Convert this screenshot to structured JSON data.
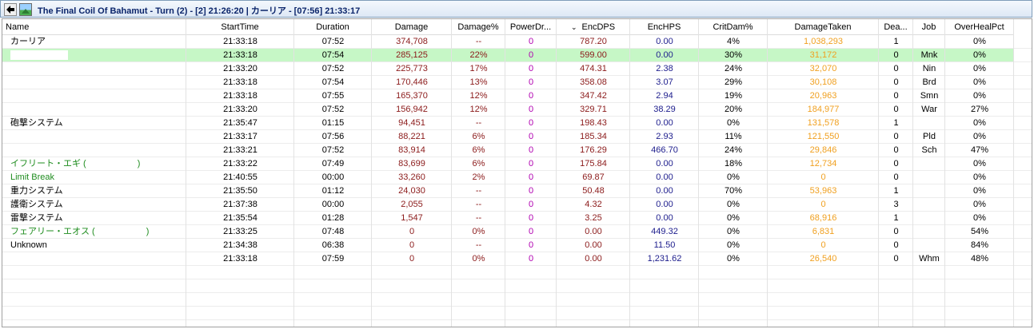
{
  "window": {
    "title": "The Final Coil Of Bahamut - Turn (2) - [2] 21:26:20 | カーリア - [07:56] 21:33:17"
  },
  "columns": [
    {
      "key": "name",
      "label": "Name"
    },
    {
      "key": "start",
      "label": "StartTime"
    },
    {
      "key": "duration",
      "label": "Duration"
    },
    {
      "key": "damage",
      "label": "Damage"
    },
    {
      "key": "damagepct",
      "label": "Damage%"
    },
    {
      "key": "powerdrain",
      "label": "PowerDr..."
    },
    {
      "key": "encdps",
      "label": "EncDPS",
      "sort_icon": "⌄"
    },
    {
      "key": "enchps",
      "label": "EncHPS"
    },
    {
      "key": "critdam",
      "label": "CritDam%"
    },
    {
      "key": "damagetaken",
      "label": "DamageTaken"
    },
    {
      "key": "deaths",
      "label": "Dea..."
    },
    {
      "key": "job",
      "label": "Job"
    },
    {
      "key": "overheal",
      "label": "OverHealPct"
    }
  ],
  "rows": [
    {
      "name": "カーリア",
      "start": "21:33:18",
      "duration": "07:52",
      "damage": "374,708",
      "damagepct": "--",
      "powerdrain": "0",
      "encdps": "787.20",
      "enchps": "0.00",
      "critdam": "4%",
      "damagetaken": "1,038,293",
      "deaths": "1",
      "job": "",
      "overheal": "0%",
      "name_color": "black"
    },
    {
      "name": "",
      "start": "21:33:18",
      "duration": "07:54",
      "damage": "285,125",
      "damagepct": "22%",
      "powerdrain": "0",
      "encdps": "599.00",
      "enchps": "0.00",
      "critdam": "30%",
      "damagetaken": "31,172",
      "deaths": "0",
      "job": "Mnk",
      "overheal": "0%",
      "name_color": "black",
      "selected": true
    },
    {
      "name": "",
      "start": "21:33:20",
      "duration": "07:52",
      "damage": "225,773",
      "damagepct": "17%",
      "powerdrain": "0",
      "encdps": "474.31",
      "enchps": "2.38",
      "critdam": "24%",
      "damagetaken": "32,070",
      "deaths": "0",
      "job": "Nin",
      "overheal": "0%",
      "name_color": "black"
    },
    {
      "name": "",
      "start": "21:33:18",
      "duration": "07:54",
      "damage": "170,446",
      "damagepct": "13%",
      "powerdrain": "0",
      "encdps": "358.08",
      "enchps": "3.07",
      "critdam": "29%",
      "damagetaken": "30,108",
      "deaths": "0",
      "job": "Brd",
      "overheal": "0%",
      "name_color": "black"
    },
    {
      "name": "",
      "start": "21:33:18",
      "duration": "07:55",
      "damage": "165,370",
      "damagepct": "12%",
      "powerdrain": "0",
      "encdps": "347.42",
      "enchps": "2.94",
      "critdam": "19%",
      "damagetaken": "20,963",
      "deaths": "0",
      "job": "Smn",
      "overheal": "0%",
      "name_color": "black"
    },
    {
      "name": "",
      "start": "21:33:20",
      "duration": "07:52",
      "damage": "156,942",
      "damagepct": "12%",
      "powerdrain": "0",
      "encdps": "329.71",
      "enchps": "38.29",
      "critdam": "20%",
      "damagetaken": "184,977",
      "deaths": "0",
      "job": "War",
      "overheal": "27%",
      "name_color": "black"
    },
    {
      "name": "砲撃システム",
      "start": "21:35:47",
      "duration": "01:15",
      "damage": "94,451",
      "damagepct": "--",
      "powerdrain": "0",
      "encdps": "198.43",
      "enchps": "0.00",
      "critdam": "0%",
      "damagetaken": "131,578",
      "deaths": "1",
      "job": "",
      "overheal": "0%",
      "name_color": "black"
    },
    {
      "name": "",
      "start": "21:33:17",
      "duration": "07:56",
      "damage": "88,221",
      "damagepct": "6%",
      "powerdrain": "0",
      "encdps": "185.34",
      "enchps": "2.93",
      "critdam": "11%",
      "damagetaken": "121,550",
      "deaths": "0",
      "job": "Pld",
      "overheal": "0%",
      "name_color": "black"
    },
    {
      "name": "",
      "start": "21:33:21",
      "duration": "07:52",
      "damage": "83,914",
      "damagepct": "6%",
      "powerdrain": "0",
      "encdps": "176.29",
      "enchps": "466.70",
      "critdam": "24%",
      "damagetaken": "29,846",
      "deaths": "0",
      "job": "Sch",
      "overheal": "47%",
      "name_color": "black"
    },
    {
      "name": "イフリート・エギ (",
      "name_suffix": ")",
      "start": "21:33:22",
      "duration": "07:49",
      "damage": "83,699",
      "damagepct": "6%",
      "powerdrain": "0",
      "encdps": "175.84",
      "enchps": "0.00",
      "critdam": "18%",
      "damagetaken": "12,734",
      "deaths": "0",
      "job": "",
      "overheal": "0%",
      "name_color": "green"
    },
    {
      "name": "Limit Break",
      "start": "21:40:55",
      "duration": "00:00",
      "damage": "33,260",
      "damagepct": "2%",
      "powerdrain": "0",
      "encdps": "69.87",
      "enchps": "0.00",
      "critdam": "0%",
      "damagetaken": "0",
      "deaths": "0",
      "job": "",
      "overheal": "0%",
      "name_color": "green"
    },
    {
      "name": "重力システム",
      "start": "21:35:50",
      "duration": "01:12",
      "damage": "24,030",
      "damagepct": "--",
      "powerdrain": "0",
      "encdps": "50.48",
      "enchps": "0.00",
      "critdam": "70%",
      "damagetaken": "53,963",
      "deaths": "1",
      "job": "",
      "overheal": "0%",
      "name_color": "black"
    },
    {
      "name": "護衛システム",
      "start": "21:37:38",
      "duration": "00:00",
      "damage": "2,055",
      "damagepct": "--",
      "powerdrain": "0",
      "encdps": "4.32",
      "enchps": "0.00",
      "critdam": "0%",
      "damagetaken": "0",
      "deaths": "3",
      "job": "",
      "overheal": "0%",
      "name_color": "black"
    },
    {
      "name": "雷撃システム",
      "start": "21:35:54",
      "duration": "01:28",
      "damage": "1,547",
      "damagepct": "--",
      "powerdrain": "0",
      "encdps": "3.25",
      "enchps": "0.00",
      "critdam": "0%",
      "damagetaken": "68,916",
      "deaths": "1",
      "job": "",
      "overheal": "0%",
      "name_color": "black"
    },
    {
      "name": "フェアリー・エオス (",
      "name_suffix": ")",
      "start": "21:33:25",
      "duration": "07:48",
      "damage": "0",
      "damagepct": "0%",
      "powerdrain": "0",
      "encdps": "0.00",
      "enchps": "449.32",
      "critdam": "0%",
      "damagetaken": "6,831",
      "deaths": "0",
      "job": "",
      "overheal": "54%",
      "name_color": "green"
    },
    {
      "name": "Unknown",
      "start": "21:34:38",
      "duration": "06:38",
      "damage": "0",
      "damagepct": "--",
      "powerdrain": "0",
      "encdps": "0.00",
      "enchps": "11.50",
      "critdam": "0%",
      "damagetaken": "0",
      "deaths": "0",
      "job": "",
      "overheal": "84%",
      "name_color": "black"
    },
    {
      "name": "",
      "start": "21:33:18",
      "duration": "07:59",
      "damage": "0",
      "damagepct": "0%",
      "powerdrain": "0",
      "encdps": "0.00",
      "enchps": "1,231.62",
      "critdam": "0%",
      "damagetaken": "26,540",
      "deaths": "0",
      "job": "Whm",
      "overheal": "48%",
      "name_color": "black"
    }
  ],
  "empty_rows": 5
}
